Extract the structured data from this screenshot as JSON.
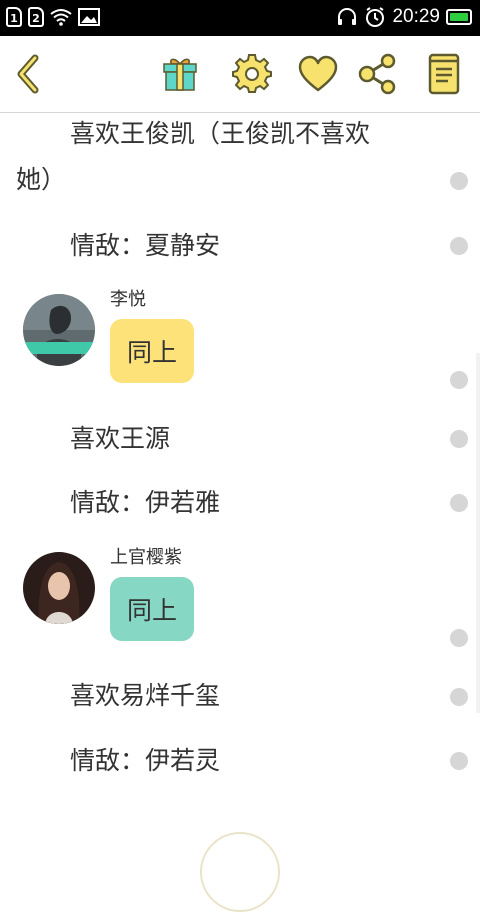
{
  "statusbar": {
    "sim1": "1",
    "sim2": "2",
    "time": "20:29",
    "icons": [
      "sim1-icon",
      "sim2-icon",
      "wifi-icon",
      "image-icon",
      "headset-icon",
      "alarm-icon",
      "battery-icon"
    ]
  },
  "toolbar": {
    "icons": [
      "back-icon",
      "gift-icon",
      "settings-icon",
      "heart-icon",
      "share-icon",
      "book-icon"
    ],
    "accent": "#f8e26e",
    "stroke": "#5c5a2e"
  },
  "messages": {
    "p1_line1": "喜欢王俊凯（王俊凯不喜欢",
    "p1_line2": "她）",
    "p2": "情敌：夏静安",
    "user1": {
      "name": "李悦",
      "text": "同上",
      "bubble_color": "#fde27a"
    },
    "p3": "喜欢王源",
    "p4": "情敌：伊若雅",
    "user2": {
      "name": "上官樱紫",
      "text": "同上",
      "bubble_color": "#86d7c4"
    },
    "p5": "喜欢易烊千玺",
    "p6": "情敌：伊若灵"
  }
}
